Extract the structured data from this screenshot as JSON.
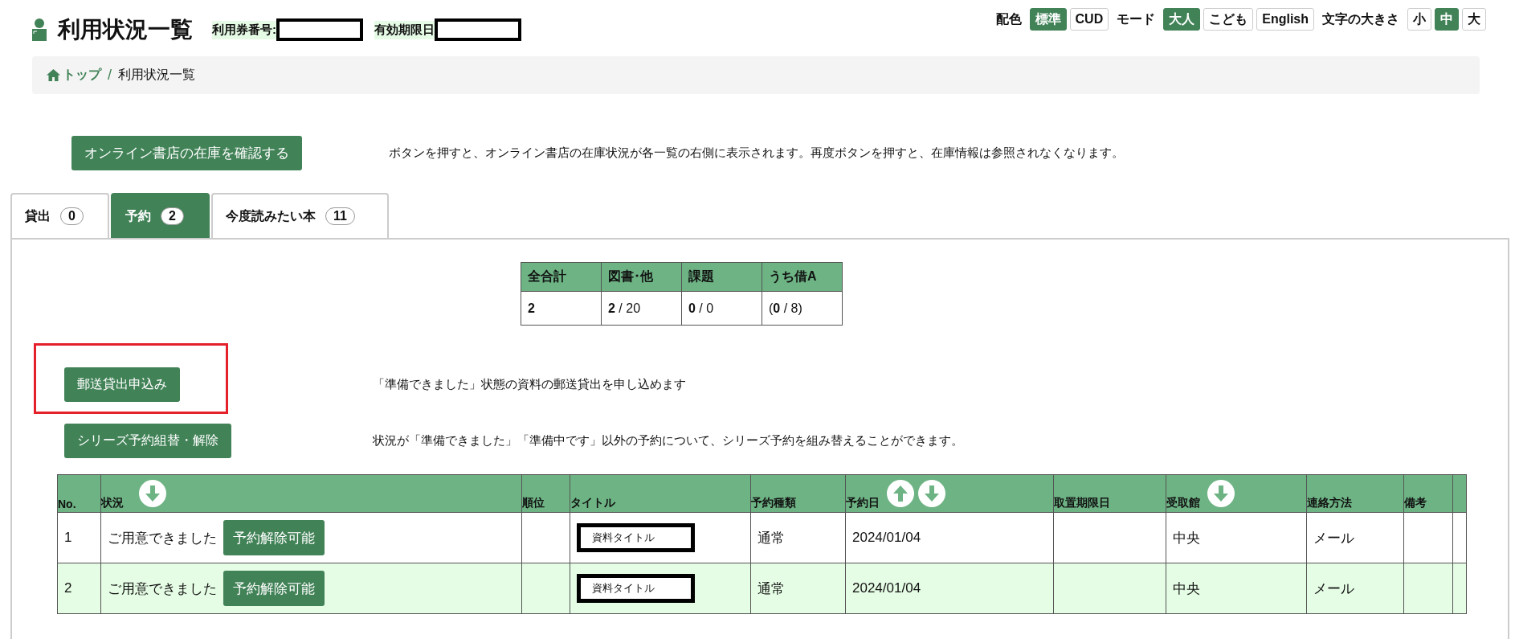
{
  "header": {
    "title": "利用状況一覧",
    "fields": [
      {
        "label": "利用券番号:"
      },
      {
        "label": "有効期限日"
      }
    ]
  },
  "display_options": [
    {
      "label": "配色",
      "options": [
        {
          "text": "標準",
          "selected": true
        },
        {
          "text": "CUD",
          "selected": false
        }
      ]
    },
    {
      "label": "モード",
      "options": [
        {
          "text": "大人",
          "selected": true
        },
        {
          "text": "こども",
          "selected": false
        },
        {
          "text": "English",
          "selected": false
        }
      ]
    },
    {
      "label": "文字の大きさ",
      "options": [
        {
          "text": "小",
          "selected": false
        },
        {
          "text": "中",
          "selected": true
        },
        {
          "text": "大",
          "selected": false
        }
      ]
    }
  ],
  "breadcrumb": {
    "items": [
      {
        "kind": "link",
        "text": "トップ"
      },
      {
        "kind": "current",
        "text": "利用状況一覧"
      }
    ],
    "separator": "/"
  },
  "stock_check": {
    "button": "オンライン書店の在庫を確認する",
    "description": "ボタンを押すと、オンライン書店の在庫状況が各一覧の右側に表示されます。再度ボタンを押すと、在庫情報は参照されなくなります。"
  },
  "tabs": [
    {
      "label": "貸出",
      "count": "0",
      "selected": false
    },
    {
      "label": "予約",
      "count": "2",
      "selected": true
    },
    {
      "label": "今度読みたい本",
      "count": "11",
      "selected": false
    }
  ],
  "summary": {
    "columns": [
      "全合計",
      "図書･他",
      "課題",
      "うち借A"
    ],
    "rows": [
      [
        "2",
        "**2** / 20",
        "**0** / 0",
        "(**0** / 8)"
      ]
    ]
  },
  "actions": [
    {
      "button": "郵送貸出申込み",
      "description": "「準備できました」状態の資料の郵送貸出を申し込めます",
      "highlighted": true
    },
    {
      "button": "シリーズ予約組替・解除",
      "description": "状況が「準備できました」「準備中です」以外の予約について、シリーズ予約を組み替えることができます。",
      "highlighted": false
    }
  ],
  "reservations": {
    "columns": [
      {
        "label": "No.",
        "sort_up": false,
        "sort_down": false
      },
      {
        "label": "状況",
        "sort_up": false,
        "sort_down": true
      },
      {
        "label": "順位",
        "sort_up": false,
        "sort_down": false
      },
      {
        "label": "タイトル",
        "sort_up": false,
        "sort_down": false
      },
      {
        "label": "予約種類",
        "sort_up": false,
        "sort_down": false
      },
      {
        "label": "予約日",
        "sort_up": true,
        "sort_down": true
      },
      {
        "label": "取置期限日",
        "sort_up": false,
        "sort_down": false
      },
      {
        "label": "受取館",
        "sort_up": false,
        "sort_down": true
      },
      {
        "label": "連絡方法",
        "sort_up": false,
        "sort_down": false
      },
      {
        "label": "備考",
        "sort_up": false,
        "sort_down": false
      }
    ],
    "rows": [
      {
        "no": "1",
        "status": "ご用意できました",
        "action": "予約解除可能",
        "title": "資料タイトル",
        "type": "通常",
        "date": "2024/01/04",
        "pickup": "中央",
        "contact": "メール"
      },
      {
        "no": "2",
        "status": "ご用意できました",
        "action": "予約解除可能",
        "title": "資料タイトル",
        "type": "通常",
        "date": "2024/01/04",
        "pickup": "中央",
        "contact": "メール"
      }
    ]
  }
}
